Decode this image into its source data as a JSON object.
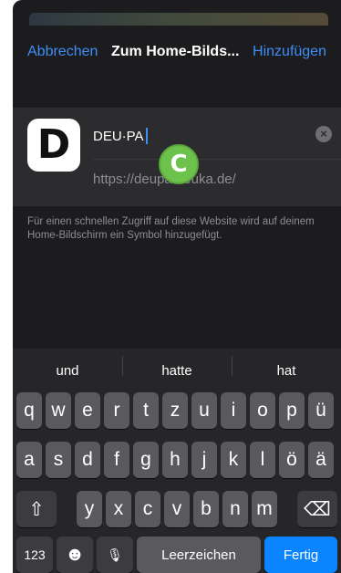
{
  "nav": {
    "cancel": "Abbrechen",
    "title": "Zum Home-Bilds...",
    "add": "Hinzufügen"
  },
  "card": {
    "icon_letter": "D",
    "name_value": "DEU·PA",
    "url": "https://deu",
    "url_rest": "pa.deuka.de/",
    "badge": "C",
    "clear_icon": "×"
  },
  "hint": "Für einen schnellen Zugriff auf diese Website wird auf deinem Home-Bildschirm ein Symbol hinzugefügt.",
  "keyboard": {
    "suggestions": [
      "und",
      "hatte",
      "hat"
    ],
    "row1": [
      "q",
      "w",
      "e",
      "r",
      "t",
      "z",
      "u",
      "i",
      "o",
      "p",
      "ü"
    ],
    "row2": [
      "a",
      "s",
      "d",
      "f",
      "g",
      "h",
      "j",
      "k",
      "l",
      "ö",
      "ä"
    ],
    "row3": [
      "y",
      "x",
      "c",
      "v",
      "b",
      "n",
      "m"
    ],
    "shift_icon": "⇧",
    "backspace_icon": "⌫",
    "numbers_key": "123",
    "emoji_icon": "☻",
    "mic_icon": "🎙",
    "space_label": "Leerzeichen",
    "done_label": "Fertig"
  }
}
